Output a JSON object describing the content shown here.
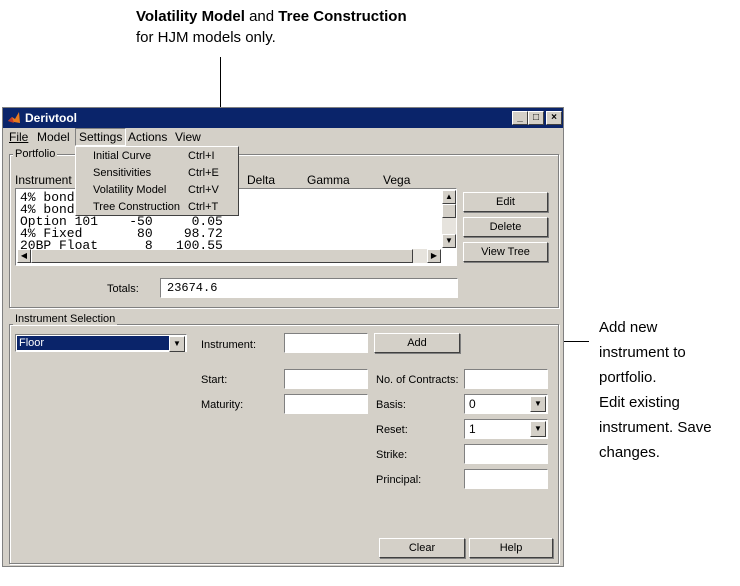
{
  "callouts": {
    "top": {
      "bold1": "Volatility Model",
      "and": " and ",
      "bold2": "Tree Construction",
      "line2": "for HJM models only."
    },
    "right": {
      "line1": "Add new",
      "line2": "instrument to",
      "line3": "portfolio.",
      "line4": "Edit  existing",
      "line5": "instrument. Save",
      "line6": "changes."
    }
  },
  "window": {
    "title": "Derivtool",
    "controls": {
      "minimize": "_",
      "maximize": "□",
      "close": "×"
    }
  },
  "menu": [
    "File",
    "Model",
    "Settings",
    "Actions",
    "View"
  ],
  "settings_menu": [
    {
      "label": "Initial Curve",
      "accel": "Ctrl+I"
    },
    {
      "label": "Sensitivities",
      "accel": "Ctrl+E"
    },
    {
      "label": "Volatility Model",
      "accel": "Ctrl+V"
    },
    {
      "label": "Tree Construction",
      "accel": "Ctrl+T"
    }
  ],
  "portfolio": {
    "group_label": "Portfolio",
    "headers": {
      "instrument": "Instrument",
      "delta": "Delta",
      "gamma": "Gamma",
      "vega": "Vega"
    },
    "rows": [
      "4% bond",
      "4% bond",
      "Option 101    -50     0.05",
      "4% Fixed       80    98.72",
      "20BP Float      8   100.55"
    ],
    "buttons": {
      "edit": "Edit",
      "delete": "Delete",
      "view_tree": "View Tree"
    },
    "totals_label": "Totals:",
    "totals_value": "23674.6"
  },
  "instrument_selection": {
    "group_label": "Instrument Selection",
    "type_value": "Floor",
    "instrument_label": "Instrument:",
    "add_button": "Add",
    "start_label": "Start:",
    "maturity_label": "Maturity:",
    "contracts_label": "No. of Contracts:",
    "basis_label": "Basis:",
    "basis_value": "0",
    "reset_label": "Reset:",
    "reset_value": "1",
    "strike_label": "Strike:",
    "principal_label": "Principal:",
    "clear_button": "Clear",
    "help_button": "Help"
  }
}
